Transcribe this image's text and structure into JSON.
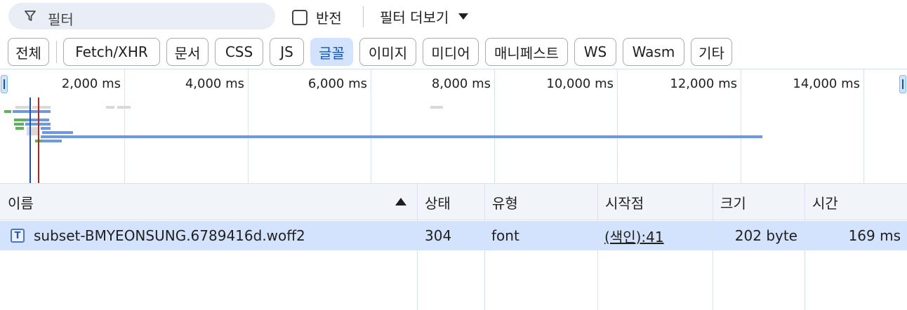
{
  "filter": {
    "placeholder": "필터",
    "invert_label": "반전",
    "more_filters_label": "필터 더보기"
  },
  "type_filters": [
    {
      "label": "전체",
      "active": false
    },
    {
      "label": "Fetch/XHR",
      "active": false
    },
    {
      "label": "문서",
      "active": false
    },
    {
      "label": "CSS",
      "active": false
    },
    {
      "label": "JS",
      "active": false
    },
    {
      "label": "글꼴",
      "active": true
    },
    {
      "label": "이미지",
      "active": false
    },
    {
      "label": "미디어",
      "active": false
    },
    {
      "label": "매니페스트",
      "active": false
    },
    {
      "label": "WS",
      "active": false
    },
    {
      "label": "Wasm",
      "active": false
    },
    {
      "label": "기타",
      "active": false
    }
  ],
  "overview": {
    "ticks": [
      "2,000 ms",
      "4,000 ms",
      "6,000 ms",
      "8,000 ms",
      "10,000 ms",
      "12,000 ms",
      "14,000 ms"
    ],
    "colors": {
      "waterfall_blue": "#6e98e2",
      "waterfall_green": "#5fb25b",
      "dom_content_loaded_line": "#1a53c7",
      "load_line": "#b3261e"
    }
  },
  "table": {
    "columns": [
      "이름",
      "상태",
      "유형",
      "시작점",
      "크기",
      "시간"
    ],
    "sort": {
      "column": "이름",
      "direction": "ascending"
    },
    "rows": [
      {
        "icon": "font-file-icon",
        "icon_glyph": "T",
        "name": "subset-BMYEONSUNG.6789416d.woff2",
        "status": "304",
        "type": "font",
        "initiator": "(색인):41",
        "size": "202 byte",
        "time": "169 ms",
        "selected": true
      }
    ]
  },
  "colors": {
    "accent": "#0b57d0",
    "selected_row": "#d3e3fd",
    "header_bg": "#f1f4f9",
    "filter_bg": "#e9eef6"
  }
}
